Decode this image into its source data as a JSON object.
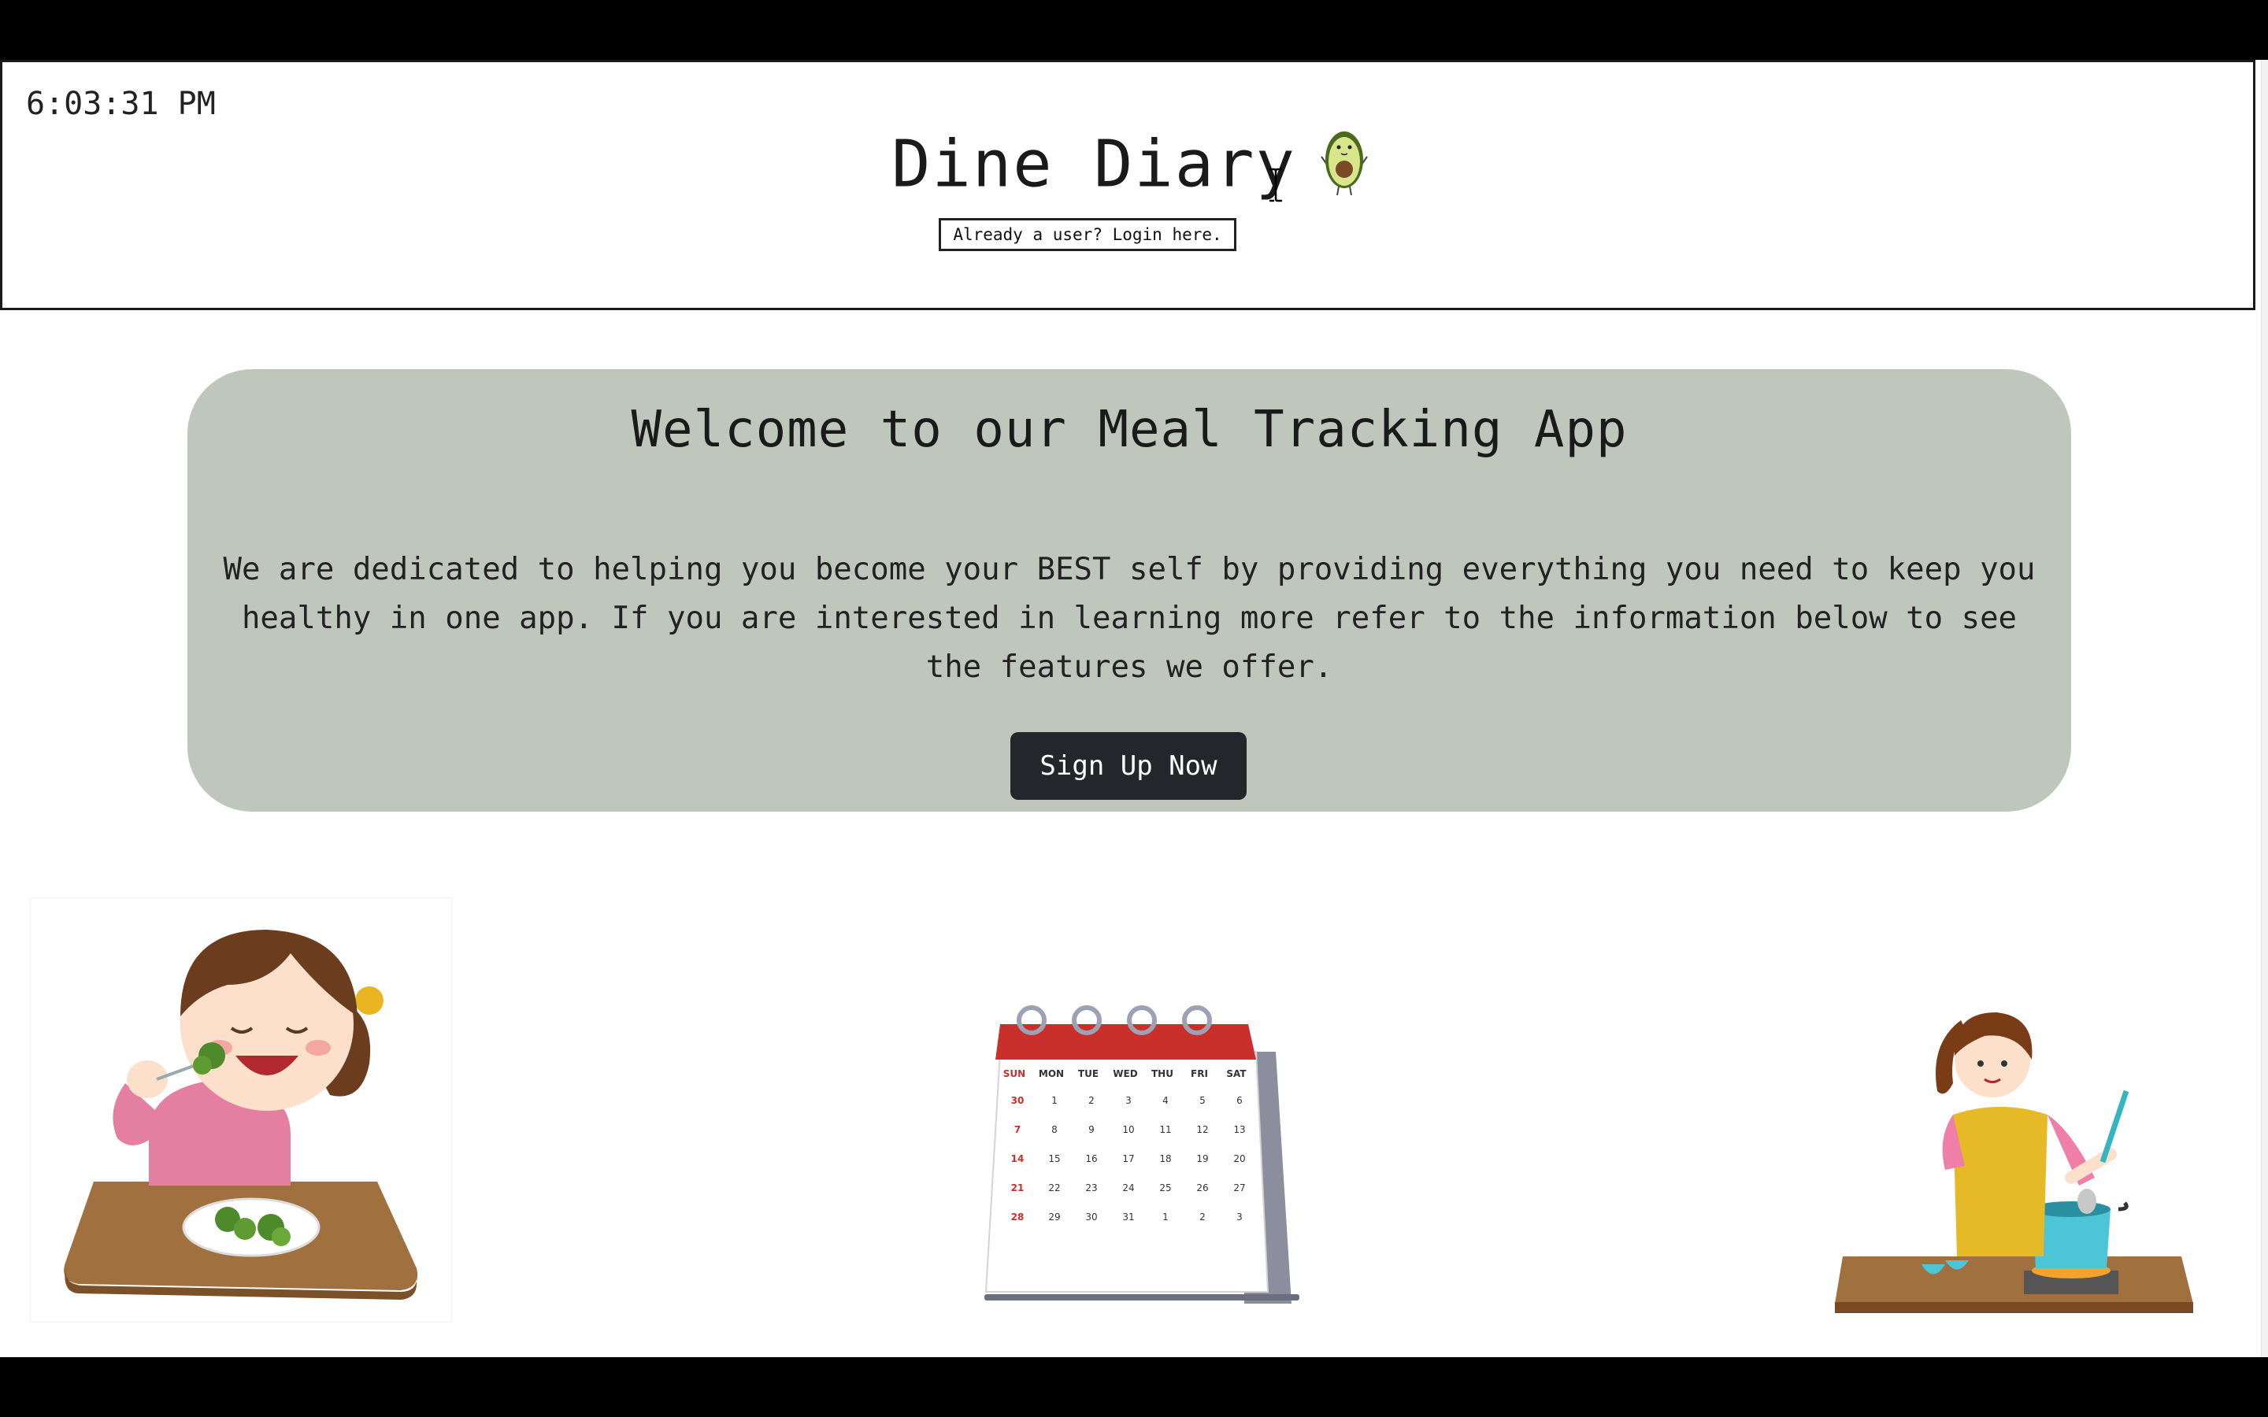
{
  "header": {
    "clock": "6:03:31 PM",
    "title": "Dine Diary",
    "logo_icon": "avocado-icon",
    "login_label": "Already a user? Login here."
  },
  "hero": {
    "title": "Welcome to our Meal Tracking App",
    "description": "We are dedicated to helping you become your BEST self by providing everything you need to keep you healthy in one app. If you are interested in learning more refer to the information below to see the features we offer.",
    "signup_label": "Sign Up Now"
  },
  "calendar": {
    "days": [
      "SUN",
      "MON",
      "TUE",
      "WED",
      "THU",
      "FRI",
      "SAT"
    ],
    "weeks": [
      [
        "30",
        "1",
        "2",
        "3",
        "4",
        "5",
        "6"
      ],
      [
        "7",
        "8",
        "9",
        "10",
        "11",
        "12",
        "13"
      ],
      [
        "14",
        "15",
        "16",
        "17",
        "18",
        "19",
        "20"
      ],
      [
        "21",
        "22",
        "23",
        "24",
        "25",
        "26",
        "27"
      ],
      [
        "28",
        "29",
        "30",
        "31",
        "1",
        "2",
        "3"
      ]
    ]
  },
  "colors": {
    "hero_bg": "#bfc6bb",
    "button_bg": "#23262b",
    "calendar_red": "#c9302c"
  }
}
